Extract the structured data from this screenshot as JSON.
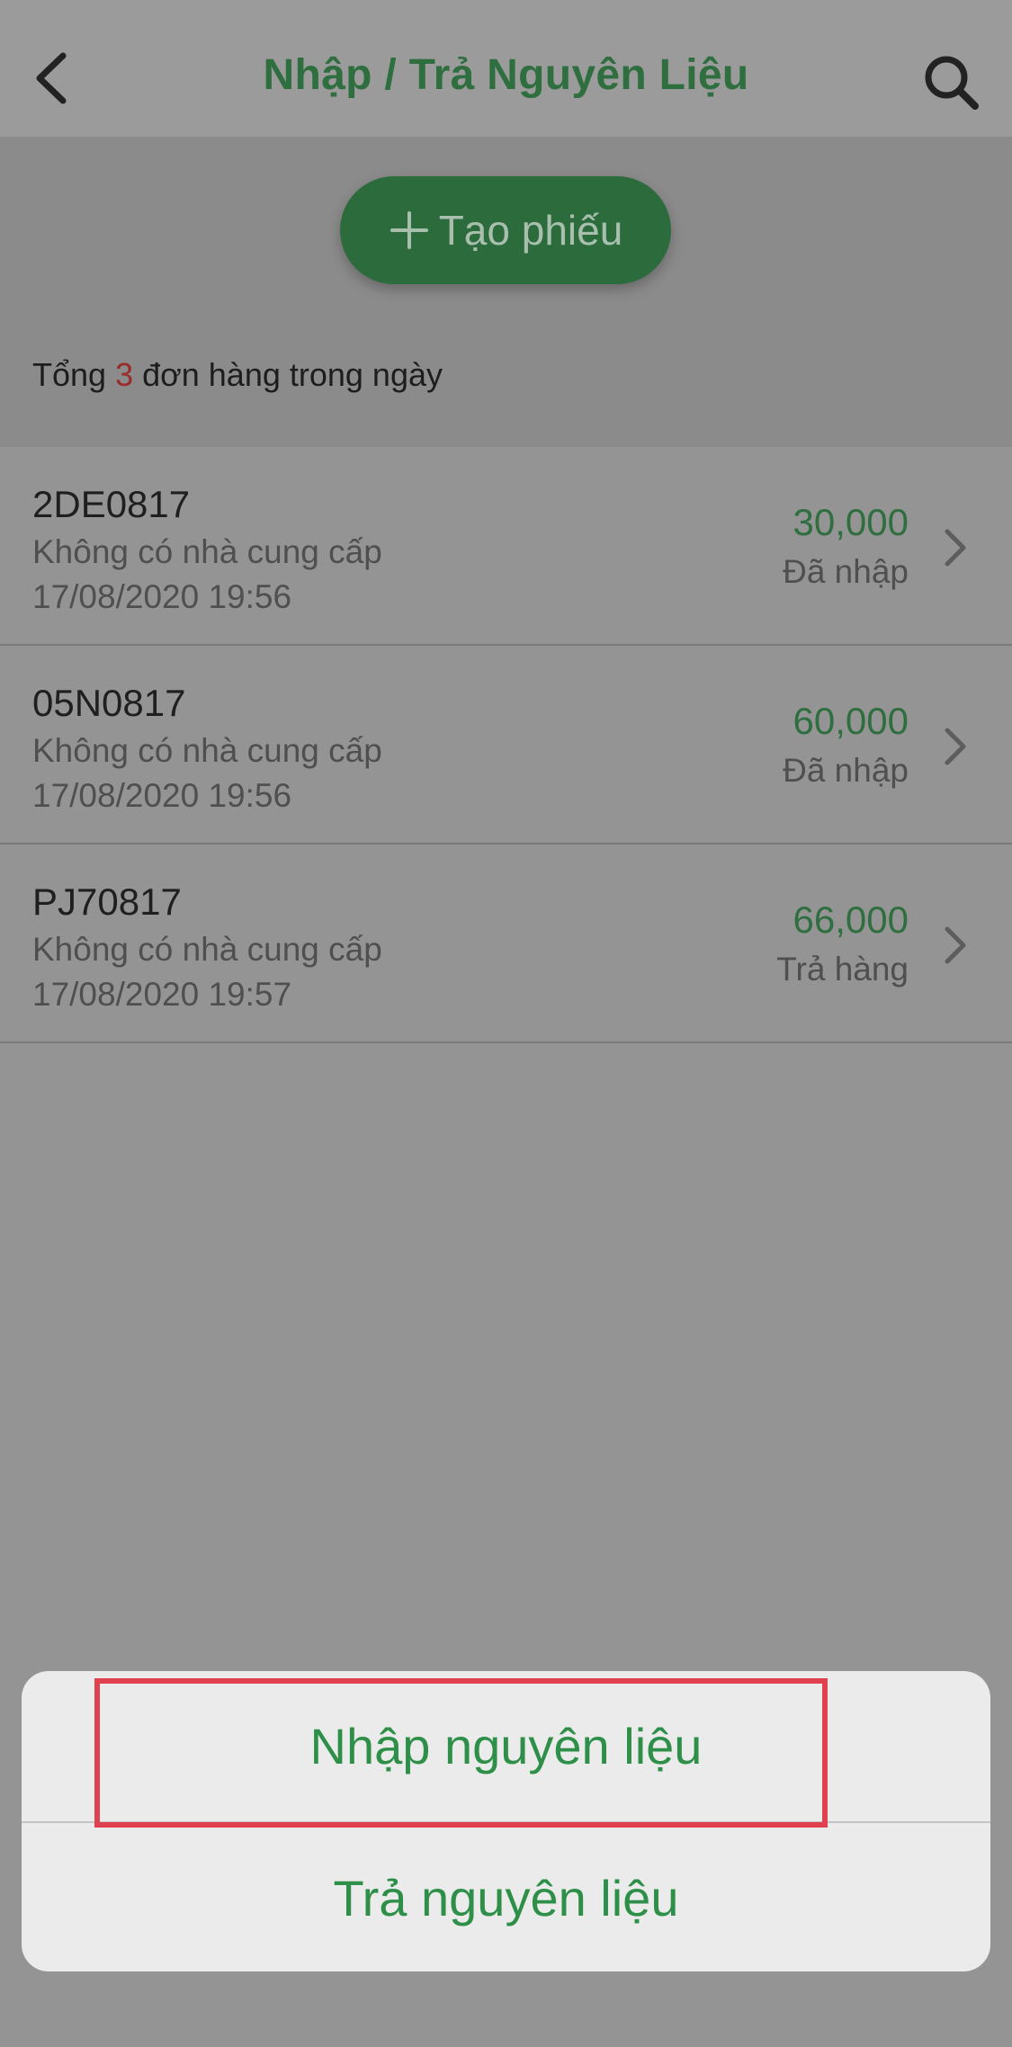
{
  "header": {
    "title": "Nhập / Trả Nguyên Liệu",
    "back_icon": "chevron-left-icon",
    "search_icon": "search-icon"
  },
  "create_button": {
    "label": "Tạo phiếu",
    "icon": "plus-icon"
  },
  "summary": {
    "prefix": "Tổng",
    "count": "3",
    "suffix": "đơn hàng trong ngày"
  },
  "orders": [
    {
      "code": "2DE0817",
      "supplier": "Không có nhà cung cấp",
      "time": "17/08/2020 19:56",
      "amount": "30,000",
      "status": "Đã nhập"
    },
    {
      "code": "05N0817",
      "supplier": "Không có nhà cung cấp",
      "time": "17/08/2020 19:56",
      "amount": "60,000",
      "status": "Đã nhập"
    },
    {
      "code": "PJ70817",
      "supplier": "Không có nhà cung cấp",
      "time": "17/08/2020 19:57",
      "amount": "66,000",
      "status": "Trả hàng"
    }
  ],
  "action_sheet": {
    "options": [
      "Nhập nguyên liệu",
      "Trả nguyên liệu"
    ],
    "highlighted_index": 0
  },
  "colors": {
    "accent_green": "#2f6e3f",
    "option_green": "#2e9048",
    "highlight_red": "#e0414f",
    "count_red": "#9a2b2b"
  }
}
